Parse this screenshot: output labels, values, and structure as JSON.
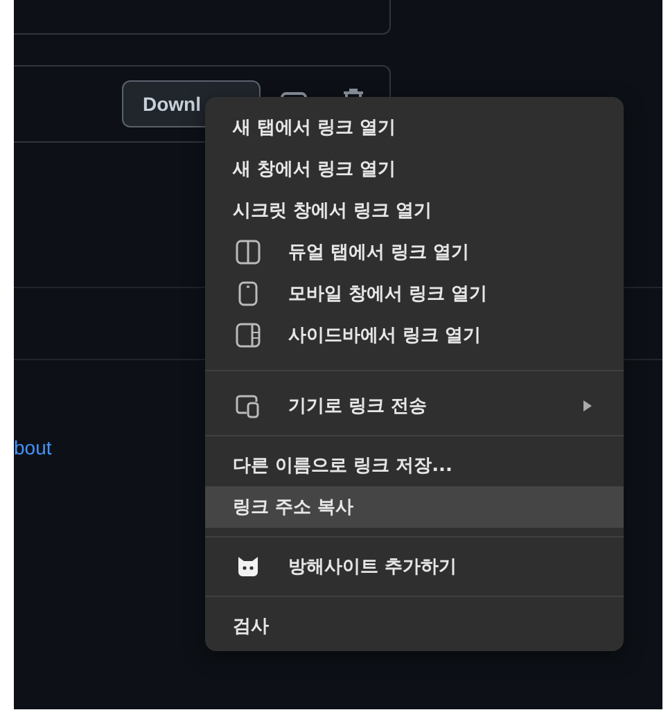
{
  "page": {
    "button": "Downl",
    "link": "bout"
  },
  "menu": {
    "items": [
      {
        "kind": "plain",
        "label": "새 탭에서 링크 열기",
        "selected": false,
        "submenu": false
      },
      {
        "kind": "plain",
        "label": "새 창에서 링크 열기",
        "selected": false,
        "submenu": false
      },
      {
        "kind": "plain",
        "label": "시크릿 창에서 링크 열기",
        "selected": false,
        "submenu": false
      },
      {
        "kind": "split",
        "label": "듀얼 탭에서 링크 열기",
        "selected": false,
        "submenu": false
      },
      {
        "kind": "phone",
        "label": "모바일 창에서 링크 열기",
        "selected": false,
        "submenu": false
      },
      {
        "kind": "sidebar",
        "label": "사이드바에서 링크 열기",
        "selected": false,
        "submenu": false
      },
      {
        "kind": "separator"
      },
      {
        "kind": "devices",
        "label": "기기로 링크 전송",
        "selected": false,
        "submenu": true
      },
      {
        "kind": "separator"
      },
      {
        "kind": "plain",
        "label": "다른 이름으로 링크 저장...",
        "selected": false,
        "submenu": false
      },
      {
        "kind": "plain",
        "label": "링크 주소 복사",
        "selected": true,
        "submenu": false
      },
      {
        "kind": "separator"
      },
      {
        "kind": "cat",
        "label": "방해사이트 추가하기",
        "selected": false,
        "submenu": false
      },
      {
        "kind": "separator"
      },
      {
        "kind": "plain",
        "label": "검사",
        "selected": false,
        "submenu": false
      }
    ]
  }
}
